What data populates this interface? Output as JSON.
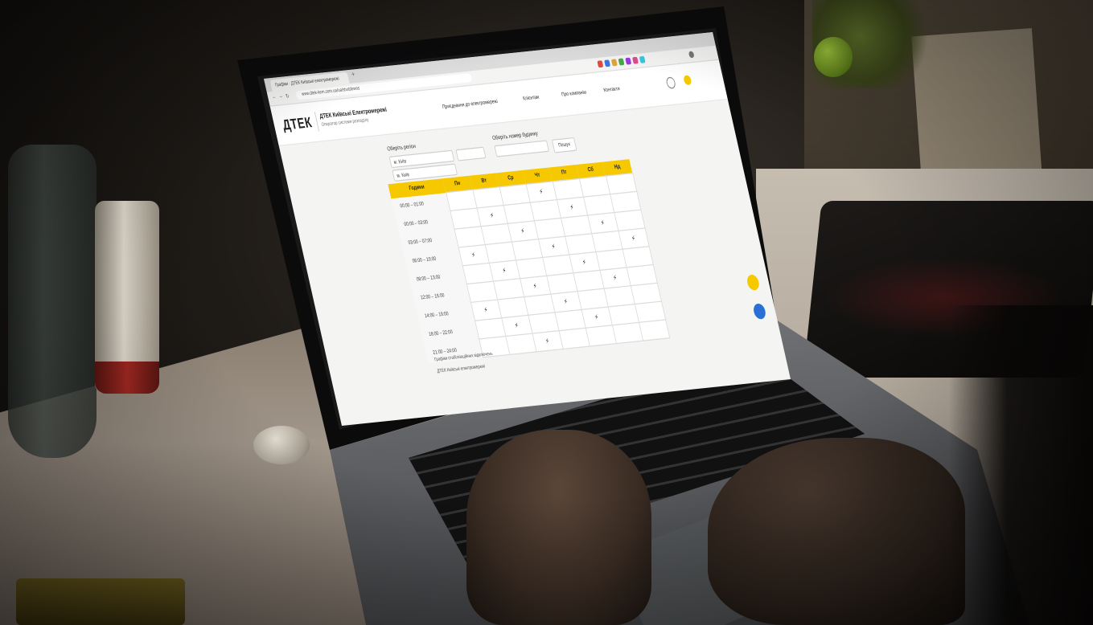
{
  "browser": {
    "tab_title": "Графіки · ДТЕК Київські електромережі",
    "url": "www.dtek-kem.com.ua/ua/shutdowns"
  },
  "site": {
    "logo": "ДТЕК",
    "brand_title": "ДТЕК Київські Електромережі",
    "brand_subtitle": "Оператор системи розподілу",
    "menu": [
      "Приєднання до електромережі",
      "Клієнтам",
      "Про компанію",
      "Контакти"
    ]
  },
  "form": {
    "region_label": "Оберіть регіон",
    "region_value": "м. Київ",
    "address_label": "Оберіть номер будинку",
    "address_value": "",
    "search_button": "Пошук"
  },
  "schedule": {
    "time_header": "Години",
    "days": [
      "Пн",
      "Вт",
      "Ср",
      "Чт",
      "Пт",
      "Сб",
      "Нд"
    ],
    "slots": [
      "00:00 – 01:00",
      "00:00 – 03:00",
      "03:00 – 07:00",
      "06:00 – 10:00",
      "09:00 – 13:00",
      "12:00 – 16:00",
      "14:00 – 19:00",
      "18:00 – 22:00",
      "21:00 – 24:00"
    ],
    "outage_mark": "⚡"
  },
  "notes": {
    "line1": "Графіки стабілізаційних відключень",
    "line2": "ДТЕК Київські електромережі"
  },
  "colors": {
    "accent_yellow": "#f6c800",
    "chat_blue": "#2a6fd6"
  }
}
